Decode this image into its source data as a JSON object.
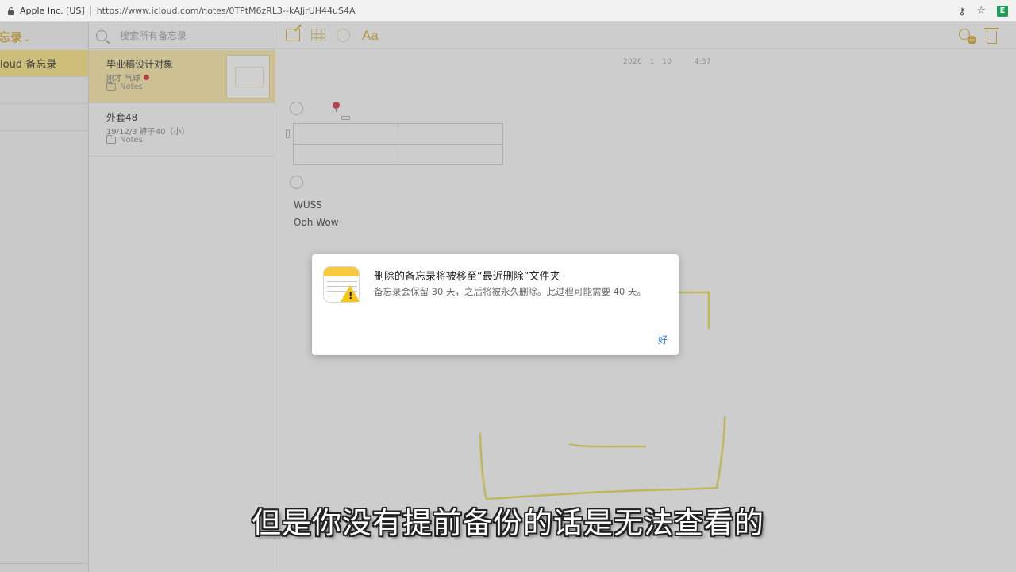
{
  "browser": {
    "site_identity": "Apple Inc. [US]",
    "url": "https://www.icloud.com/notes/0TPtM6zRL3--kAJjrUH44uS4A"
  },
  "sidebar": {
    "title": "忘录",
    "items": [
      {
        "label": "loud 备忘录",
        "active": true
      },
      {
        "label": "",
        "active": false
      },
      {
        "label": "",
        "active": false
      }
    ]
  },
  "search": {
    "placeholder": "搜索所有备忘录"
  },
  "notes": [
    {
      "title": "毕业稿设计对象",
      "meta": "刚才 气球",
      "folder": "Notes",
      "selected": true
    },
    {
      "title": "外套48",
      "meta": "19/12/3 裤子40（小）",
      "folder": "Notes",
      "selected": false
    }
  ],
  "toolbar": {
    "format_label": "Aa"
  },
  "editor": {
    "date": "2020   1   10         4:37",
    "line1": "WUSS",
    "line2": "Ooh   Wow"
  },
  "dialog": {
    "title": "删除的备忘录将被移至“最近删除”文件夹",
    "message": "备忘录会保留 30 天，之后将被永久删除。此过程可能需要 40 天。",
    "ok_label": "好"
  },
  "subtitle": "但是你没有提前备份的话是无法查看的",
  "colors": {
    "accent": "#d4a72c",
    "selected_note": "#fbe7a0",
    "link": "#2a7fd4"
  }
}
